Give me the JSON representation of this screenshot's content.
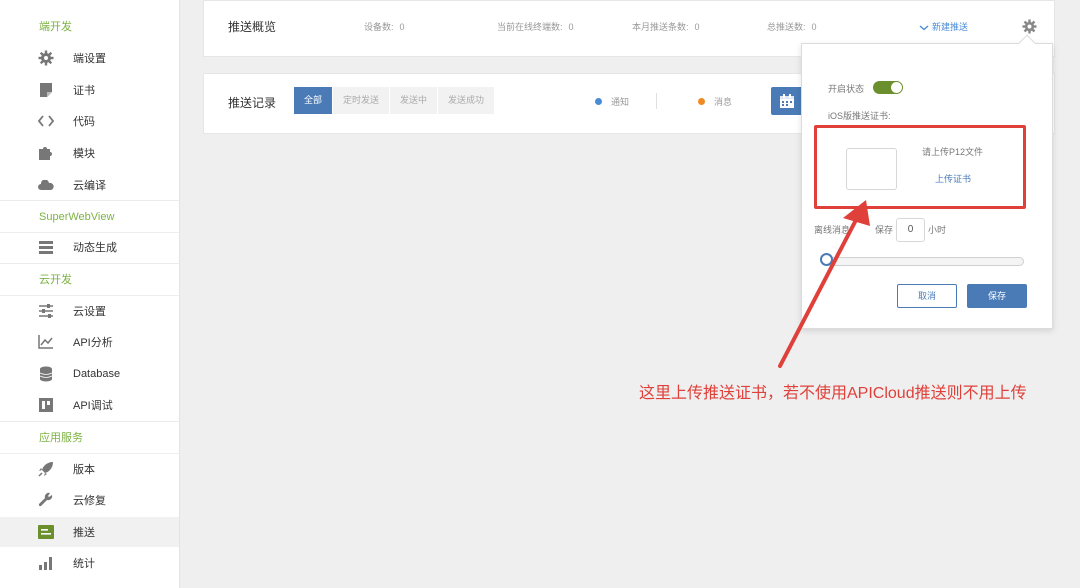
{
  "sidebar": {
    "sections": [
      {
        "title": "端开发",
        "items": [
          {
            "label": "端设置",
            "icon": "gear-icon"
          },
          {
            "label": "证书",
            "icon": "certificate-icon"
          },
          {
            "label": "代码",
            "icon": "code-icon"
          },
          {
            "label": "模块",
            "icon": "puzzle-icon"
          },
          {
            "label": "云编译",
            "icon": "cloud-icon"
          }
        ]
      },
      {
        "title": "SuperWebView",
        "items": [
          {
            "label": "动态生成",
            "icon": "layers-icon"
          }
        ]
      },
      {
        "title": "云开发",
        "items": [
          {
            "label": "云设置",
            "icon": "sliders-icon"
          },
          {
            "label": "API分析",
            "icon": "chart-icon"
          },
          {
            "label": "Database",
            "icon": "database-icon"
          },
          {
            "label": "API调试",
            "icon": "debug-icon"
          }
        ]
      },
      {
        "title": "应用服务",
        "items": [
          {
            "label": "版本",
            "icon": "rocket-icon"
          },
          {
            "label": "云修复",
            "icon": "wrench-icon"
          },
          {
            "label": "推送",
            "icon": "push-icon"
          },
          {
            "label": "统计",
            "icon": "bar-chart-icon"
          }
        ]
      }
    ],
    "active_item": "推送"
  },
  "overview": {
    "title": "推送概览",
    "stats": [
      {
        "label": "设备数:",
        "value": "0"
      },
      {
        "label": "当前在线终端数:",
        "value": "0"
      },
      {
        "label": "本月推送条数:",
        "value": "0"
      },
      {
        "label": "总推送数:",
        "value": "0"
      }
    ],
    "new_push": "新建推送"
  },
  "records": {
    "title": "推送记录",
    "tabs": [
      "全部",
      "定时发送",
      "发送中",
      "发送成功"
    ],
    "legend": [
      {
        "label": "通知",
        "color": "#4a8bd6"
      },
      {
        "label": "消息",
        "color": "#f08a24"
      }
    ]
  },
  "popover": {
    "enable_label": "开启状态",
    "enabled": true,
    "ios_cert_label": "iOS版推送证书:",
    "upload_hint": "请上传P12文件",
    "upload_link": "上传证书",
    "offline_label": "离线消息",
    "keep_label": "保存",
    "keep_value": "0",
    "unit": "小时",
    "slider_value": 0,
    "cancel": "取消",
    "save": "保存"
  },
  "annotation": "这里上传推送证书，若不使用APICloud推送则不用上传",
  "colors": {
    "accent": "#4a7bb6",
    "green": "#7cb342",
    "annotation_red": "#e0403a"
  }
}
